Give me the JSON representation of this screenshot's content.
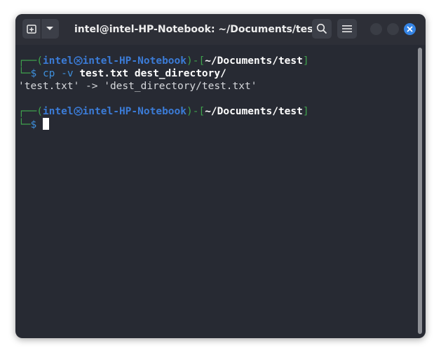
{
  "window": {
    "title": "intel@intel-HP-Notebook: ~/Documents/test",
    "accent_color": "#3584e4",
    "buttons": {
      "new_tab_icon": "new-tab-icon",
      "dropdown_icon": "chevron-down-icon",
      "search_icon": "search-icon",
      "menu_icon": "hamburger-menu-icon",
      "minimize_icon": "minimize-icon",
      "maximize_icon": "maximize-icon",
      "close_icon": "close-icon"
    }
  },
  "terminal": {
    "prompt1": {
      "corner": "┌──(",
      "user": "intel",
      "host": "intel-HP-Notebook",
      "mid": ")-[",
      "path": "~/Documents/test",
      "end": "]",
      "corner2": "└─",
      "symbol": "$ ",
      "command": "cp",
      "flag": " -v ",
      "args": "test.txt dest_directory/"
    },
    "output": "'test.txt' -> 'dest_directory/test.txt'",
    "prompt2": {
      "corner": "┌──(",
      "user": "intel",
      "host": "intel-HP-Notebook",
      "mid": ")-[",
      "path": "~/Documents/test",
      "end": "]",
      "corner2": "└─",
      "symbol": "$ "
    }
  }
}
